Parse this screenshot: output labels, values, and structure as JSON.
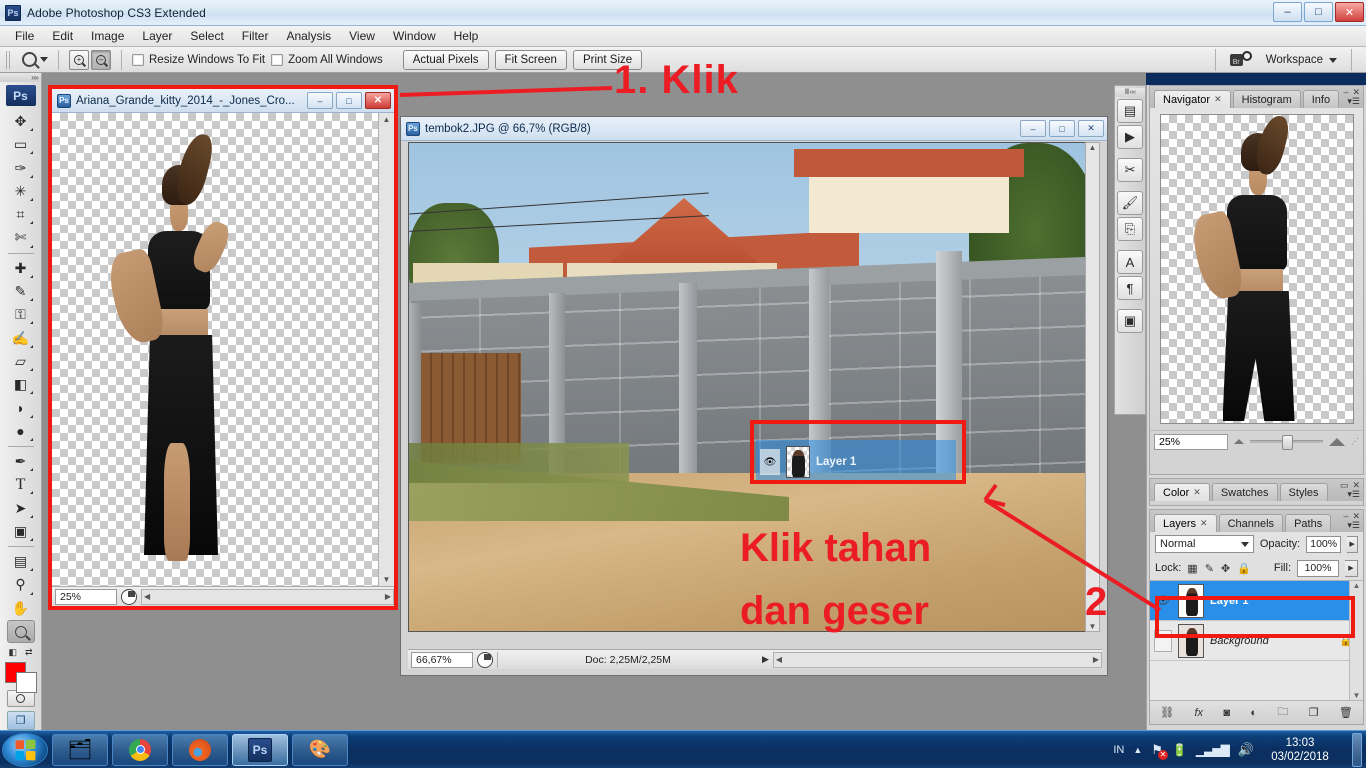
{
  "window": {
    "app_title": "Adobe Photoshop CS3 Extended",
    "app_icon": "Ps",
    "minimize": "–",
    "maximize": "□",
    "close": "✕"
  },
  "menubar": {
    "items": [
      "File",
      "Edit",
      "Image",
      "Layer",
      "Select",
      "Filter",
      "Analysis",
      "View",
      "Window",
      "Help"
    ]
  },
  "optionsbar": {
    "tool_icon": "zoom-tool",
    "zoom_in_label": "+",
    "zoom_out_label": "–",
    "checkboxes": [
      {
        "label": "Resize Windows To Fit",
        "checked": false
      },
      {
        "label": "Zoom All Windows",
        "checked": false
      }
    ],
    "buttons": [
      "Actual Pixels",
      "Fit Screen",
      "Print Size"
    ],
    "bridge_icon": "Br",
    "workspace_label": "Workspace"
  },
  "toolbox": {
    "logo": "Ps",
    "tools": [
      {
        "name": "move-tool",
        "glyph": "✥"
      },
      {
        "name": "marquee-tool",
        "glyph": "▭"
      },
      {
        "name": "lasso-tool",
        "glyph": "✑"
      },
      {
        "name": "magic-wand-tool",
        "glyph": "✹"
      },
      {
        "name": "crop-tool",
        "glyph": "⌗"
      },
      {
        "name": "slice-tool",
        "glyph": "✂"
      },
      {
        "name": "healing-brush-tool",
        "glyph": "✚"
      },
      {
        "name": "brush-tool",
        "glyph": "✎"
      },
      {
        "name": "clone-stamp-tool",
        "glyph": "⚒"
      },
      {
        "name": "history-brush-tool",
        "glyph": "✍"
      },
      {
        "name": "eraser-tool",
        "glyph": "▱"
      },
      {
        "name": "gradient-tool",
        "glyph": "◨"
      },
      {
        "name": "blur-tool",
        "glyph": "💧"
      },
      {
        "name": "dodge-tool",
        "glyph": "🍭"
      },
      {
        "name": "pen-tool",
        "glyph": "✒"
      },
      {
        "name": "type-tool",
        "glyph": "T"
      },
      {
        "name": "path-selection-tool",
        "glyph": "➚"
      },
      {
        "name": "shape-tool",
        "glyph": "▢"
      },
      {
        "name": "notes-tool",
        "glyph": "🗒"
      },
      {
        "name": "eyedropper-tool",
        "glyph": "⚲"
      },
      {
        "name": "hand-tool",
        "glyph": "✋"
      },
      {
        "name": "zoom-tool",
        "glyph": "🔍"
      }
    ],
    "foreground_color": "#fe0000",
    "background_color": "#ffffff",
    "selected_tool": "zoom-tool"
  },
  "doc1": {
    "title": "Ariana_Grande_kitty_2014_-_Jones_Cro...",
    "zoom": "25%",
    "min": "–",
    "max": "□",
    "close": "✕"
  },
  "doc2": {
    "title": "tembok2.JPG @ 66,7% (RGB/8)",
    "zoom": "66,67%",
    "doc_info": "Doc: 2,25M/2,25M",
    "min": "–",
    "max": "□",
    "close": "✕",
    "drag_ghost_label": "Layer 1"
  },
  "dockstrip": {
    "icons": [
      {
        "name": "brushes-dock-icon",
        "glyph": "▤"
      },
      {
        "name": "animation-dock-icon",
        "glyph": "▶"
      },
      {
        "name": "tool-presets-dock-icon",
        "glyph": "✂"
      },
      {
        "name": "brush-presets-dock-icon",
        "glyph": "🖌"
      },
      {
        "name": "clone-source-dock-icon",
        "glyph": "⎘"
      },
      {
        "name": "character-dock-icon",
        "glyph": "A"
      },
      {
        "name": "paragraph-dock-icon",
        "glyph": "¶"
      },
      {
        "name": "layer-comps-dock-icon",
        "glyph": "▣"
      }
    ]
  },
  "navigator_panel": {
    "tabs": [
      {
        "label": "Navigator",
        "active": true,
        "closable": true
      },
      {
        "label": "Histogram",
        "active": false,
        "closable": false
      },
      {
        "label": "Info",
        "active": false,
        "closable": false
      }
    ],
    "zoom_value": "25%"
  },
  "color_panel": {
    "tabs": [
      {
        "label": "Color",
        "active": true,
        "closable": true
      },
      {
        "label": "Swatches",
        "active": false,
        "closable": false
      },
      {
        "label": "Styles",
        "active": false,
        "closable": false
      }
    ]
  },
  "layers_panel": {
    "tabs": [
      {
        "label": "Layers",
        "active": true,
        "closable": true
      },
      {
        "label": "Channels",
        "active": false,
        "closable": false
      },
      {
        "label": "Paths",
        "active": false,
        "closable": false
      }
    ],
    "blend_mode": "Normal",
    "opacity_label": "Opacity:",
    "opacity_value": "100%",
    "lock_label": "Lock:",
    "lock_icons": [
      "▦",
      "✎",
      "✥",
      "🔒"
    ],
    "fill_label": "Fill:",
    "fill_value": "100%",
    "layers": [
      {
        "name": "Layer 1",
        "visible": true,
        "selected": true,
        "locked": false,
        "italic": false
      },
      {
        "name": "Background",
        "visible": false,
        "selected": false,
        "locked": true,
        "italic": true
      }
    ],
    "footer_icons": [
      {
        "name": "link-layers-icon",
        "glyph": "⛓"
      },
      {
        "name": "layer-style-icon",
        "glyph": "fx"
      },
      {
        "name": "layer-mask-icon",
        "glyph": "◙"
      },
      {
        "name": "adjustment-layer-icon",
        "glyph": "◐"
      },
      {
        "name": "new-group-icon",
        "glyph": "🗀"
      },
      {
        "name": "new-layer-icon",
        "glyph": "❐"
      },
      {
        "name": "delete-layer-icon",
        "glyph": "🗑"
      }
    ]
  },
  "annotations": [
    {
      "id": "step-1",
      "text": "1. Klik"
    },
    {
      "id": "step-2-line1",
      "text": "Klik tahan"
    },
    {
      "id": "step-2-line2",
      "text": "dan geser"
    },
    {
      "id": "step-2-number",
      "text": "2"
    }
  ],
  "taskbar": {
    "start_label": "Start",
    "items": [
      {
        "name": "file-explorer-taskbar-icon",
        "glyph": "🗂"
      },
      {
        "name": "google-chrome-taskbar-icon",
        "glyph": "◉"
      },
      {
        "name": "mozilla-firefox-taskbar-icon",
        "glyph": "🦊"
      },
      {
        "name": "photoshop-taskbar-icon",
        "glyph": "Ps"
      },
      {
        "name": "paint-taskbar-icon",
        "glyph": "🎨"
      }
    ],
    "language": "IN",
    "tray_icons": [
      {
        "name": "show-hidden-icons-icon",
        "glyph": "▲"
      },
      {
        "name": "network-error-icon",
        "glyph": "🚩"
      },
      {
        "name": "battery-icon",
        "glyph": "🔋"
      },
      {
        "name": "signal-icon",
        "glyph": "📶"
      },
      {
        "name": "volume-icon",
        "glyph": "🔊"
      }
    ],
    "time": "13:03",
    "date": "03/02/2018"
  },
  "colors": {
    "annotation_red": "#ec1c24",
    "highlight_red": "#f01a12",
    "layer_selected_blue": "#2a8fe8",
    "taskbar_blue": "#0a2f60"
  }
}
